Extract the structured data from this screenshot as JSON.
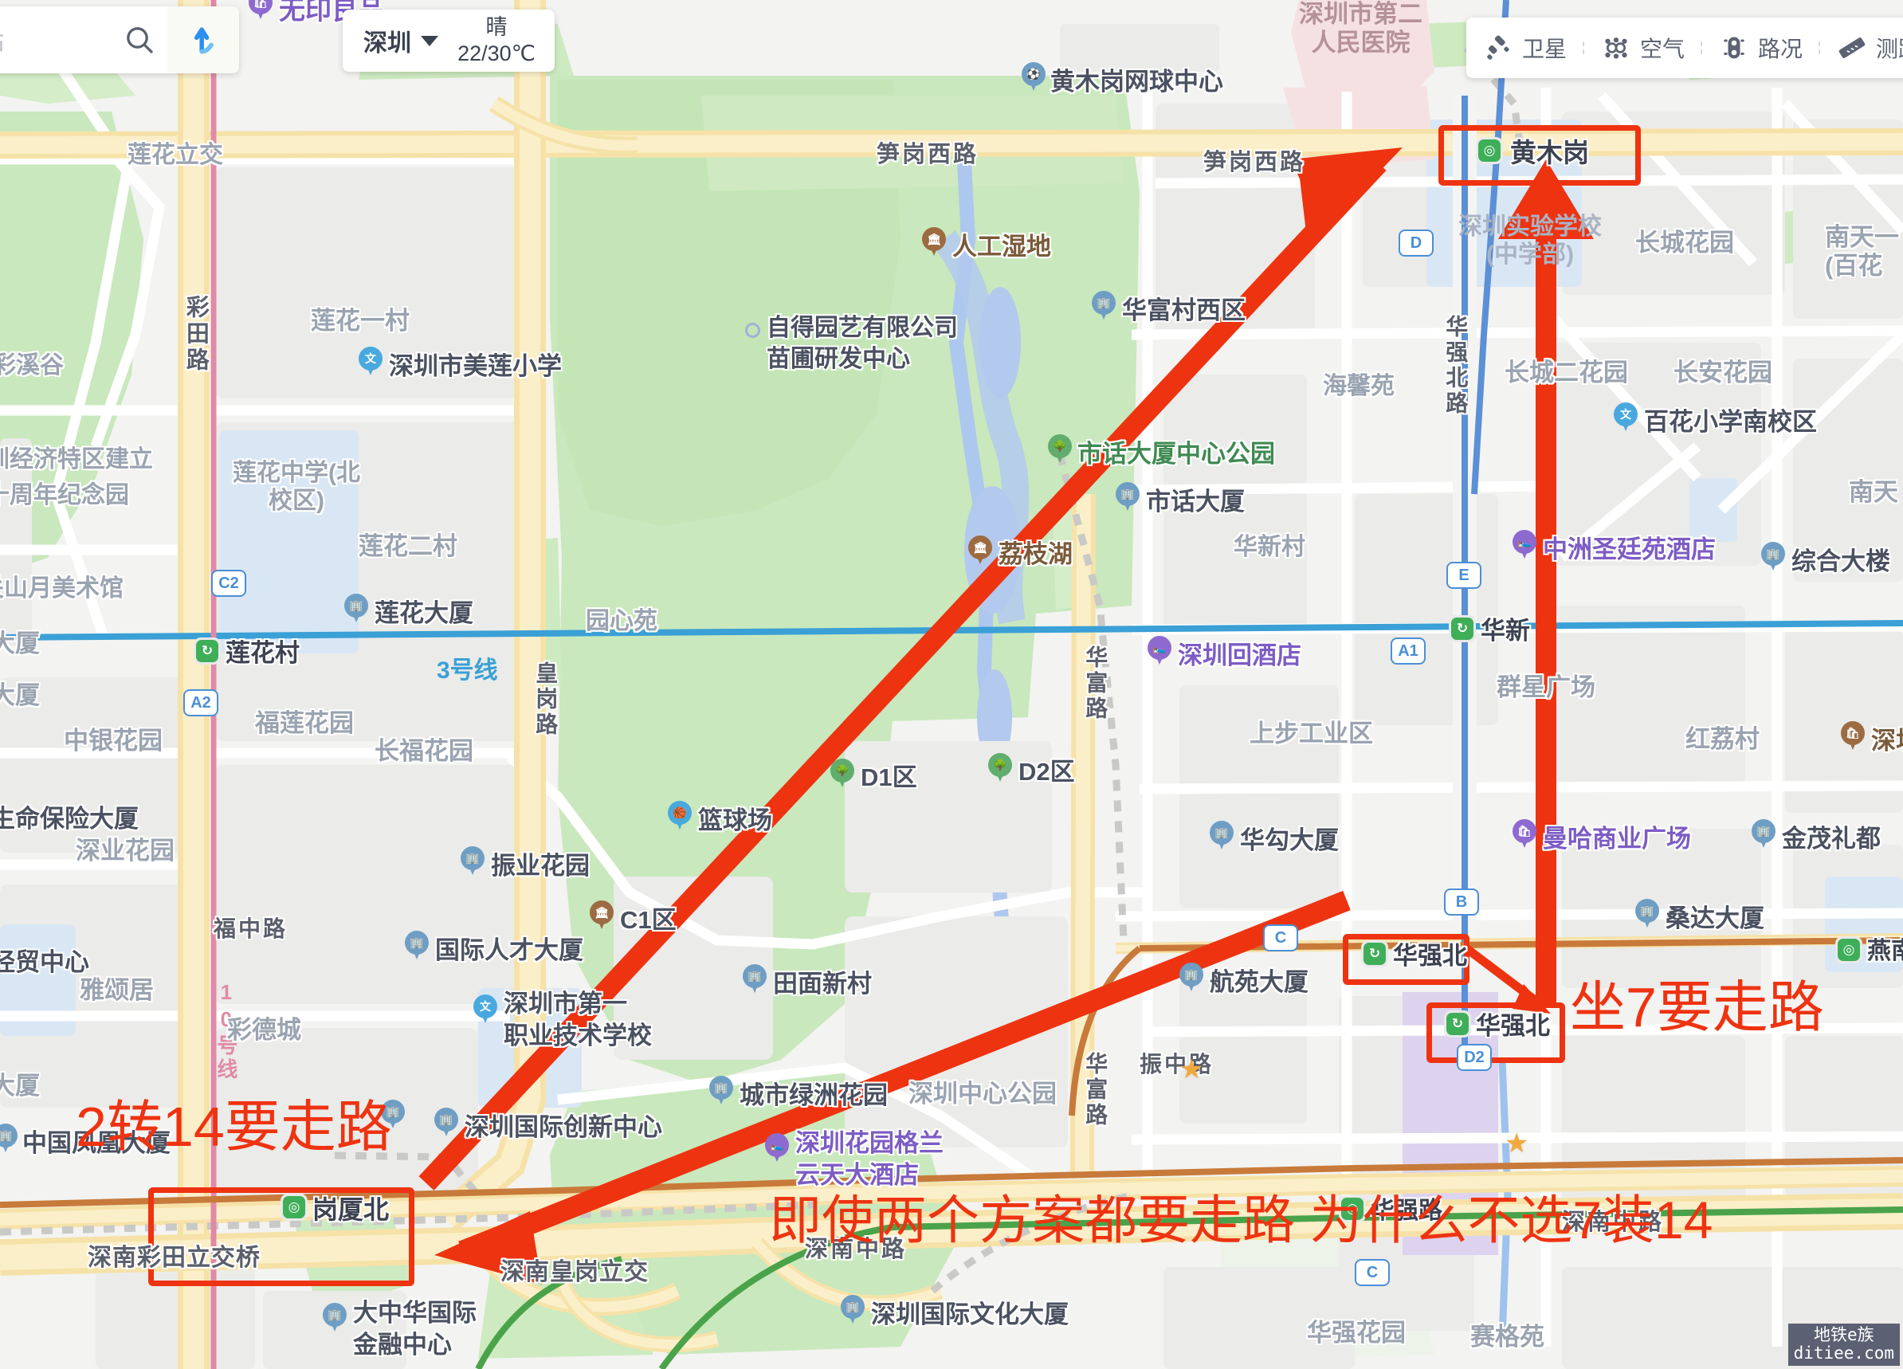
{
  "app": {
    "search": {
      "placeholder": "站、地铁站",
      "search_icon": "search-icon",
      "direction_icon": "route-arrow-icon"
    },
    "city": {
      "name": "深圳",
      "weather_condition": "晴",
      "weather_temp": "22/30℃",
      "caret_icon": "chevron-down-icon"
    },
    "toolbar": [
      {
        "label": "卫星",
        "icon": "satellite-icon"
      },
      {
        "label": "空气",
        "icon": "air-quality-icon"
      },
      {
        "label": "路况",
        "icon": "traffic-light-icon"
      },
      {
        "label": "测距",
        "icon": "ruler-icon"
      }
    ],
    "watermark": {
      "line1": "地铁e族",
      "line2": "ditiee.com"
    }
  },
  "annotations": {
    "colors": {
      "red": "#ee3311"
    },
    "texts": [
      {
        "id": "ann-2to14",
        "text": "2转14要走路"
      },
      {
        "id": "ann-line7",
        "text": "坐7要走路"
      },
      {
        "id": "ann-question",
        "text": "即使两个方案都要走路 为什么不选7装14"
      }
    ],
    "highlight_boxes": [
      {
        "id": "box-huangmugang",
        "station": "黄木岗"
      },
      {
        "id": "box-huaqiangbei-upper",
        "station": "华强北"
      },
      {
        "id": "box-huaqiangbei-lower",
        "station": "华强北"
      },
      {
        "id": "box-gangxiabei",
        "station": "岗厦北"
      }
    ],
    "arrows": [
      {
        "id": "arrow-to-huangmugang",
        "from": "岗厦北区域",
        "to": "黄木岗"
      },
      {
        "id": "arrow-to-gangxiabei",
        "from": "华强北区域",
        "to": "岗厦北"
      },
      {
        "id": "arrow-up-huangmugang",
        "from": "华强北",
        "to": "黄木岗"
      },
      {
        "id": "arrow-short-huaqiangbei",
        "from": "华强北上",
        "to": "华强北下"
      }
    ]
  },
  "map": {
    "metro_lines": [
      {
        "name": "3号线",
        "color": "#3aa0d6"
      },
      {
        "name": "10号线",
        "color": "#e08aa6"
      }
    ],
    "stations": [
      {
        "name": "黄木岗",
        "type": "normal"
      },
      {
        "name": "华新",
        "type": "transfer"
      },
      {
        "name": "华强北",
        "type": "transfer"
      },
      {
        "name": "华强北",
        "type": "transfer"
      },
      {
        "name": "华强路",
        "type": "normal"
      },
      {
        "name": "莲花村",
        "type": "transfer"
      },
      {
        "name": "岗厦北",
        "type": "normal"
      },
      {
        "name": "燕南",
        "type": "normal"
      }
    ],
    "exits": [
      "C2",
      "A2",
      "A1",
      "B",
      "C",
      "D",
      "E",
      "D2"
    ],
    "roads": [
      "笋岗西路",
      "笋岗西路",
      "彩田路",
      "华强北路",
      "皇岗路",
      "华富路",
      "福中路",
      "振中路",
      "华富路",
      "深南中路",
      "深南中路",
      "深南彩田立交桥",
      "深南皇岗立交",
      "3号线",
      "10号线"
    ],
    "area_labels": [
      "莲花立交",
      "莲花一村",
      "莲花中学(北校区)",
      "莲花二村",
      "彩溪谷",
      "圳经济特区建立",
      "十周年纪念园",
      "关山月美术馆",
      "园心苑",
      "福莲花园",
      "长福花园",
      "中银花园",
      "深业花园",
      "雅颂居",
      "彩德城",
      "海馨苑",
      "华新村",
      "上步工业区",
      "群星广场",
      "长城花园",
      "长城二花园",
      "长安花园",
      "南天一(百花",
      "南天",
      "红荔村",
      "深圳中心公园",
      "华强花园",
      "赛格苑"
    ],
    "pois": [
      {
        "name": "黄木岗网球中心",
        "icon": "sports-pin",
        "color": "blue"
      },
      {
        "name": "人工湿地",
        "icon": "landmark-pin",
        "color": "brown"
      },
      {
        "name": "自得园艺有限公司\n苗圃研发中心",
        "icon": "dot",
        "color": "none"
      },
      {
        "name": "深圳市美莲小学",
        "icon": "school-pin",
        "color": "cyan"
      },
      {
        "name": "华富村西区",
        "icon": "building-pin",
        "color": "blue"
      },
      {
        "name": "市话大厦中心公园",
        "icon": "park-pin",
        "color": "green"
      },
      {
        "name": "市话大厦",
        "icon": "building-pin",
        "color": "blue"
      },
      {
        "name": "莲花大厦",
        "icon": "building-pin",
        "color": "blue"
      },
      {
        "name": "荔枝湖",
        "icon": "landmark-pin",
        "color": "brown"
      },
      {
        "name": "深圳回酒店",
        "icon": "hotel-pin",
        "color": "purple"
      },
      {
        "name": "中洲圣廷苑酒店",
        "icon": "hotel-pin",
        "color": "purple"
      },
      {
        "name": "百花小学南校区",
        "icon": "school-pin",
        "color": "cyan"
      },
      {
        "name": "综合大楼",
        "icon": "building-pin",
        "color": "blue"
      },
      {
        "name": "深圳",
        "icon": "shop-pin",
        "color": "brown"
      },
      {
        "name": "D1区",
        "icon": "park-pin",
        "color": "green"
      },
      {
        "name": "D2区",
        "icon": "park-pin",
        "color": "green"
      },
      {
        "name": "C1区",
        "icon": "landmark-pin",
        "color": "brown"
      },
      {
        "name": "篮球场",
        "icon": "sports-pin",
        "color": "cyan"
      },
      {
        "name": "振业花园",
        "icon": "building-pin",
        "color": "blue"
      },
      {
        "name": "国际人才大厦",
        "icon": "building-pin",
        "color": "blue"
      },
      {
        "name": "田面新村",
        "icon": "building-pin",
        "color": "blue"
      },
      {
        "name": "深圳市第一\n职业技术学校",
        "icon": "school-pin",
        "color": "cyan"
      },
      {
        "name": "城市绿洲花园",
        "icon": "building-pin",
        "color": "blue"
      },
      {
        "name": "深圳国际创新中心",
        "icon": "building-pin",
        "color": "blue"
      },
      {
        "name": "深圳花园格兰\n云天大酒店",
        "icon": "hotel-pin",
        "color": "purple"
      },
      {
        "name": "深圳国际文化大厦",
        "icon": "building-pin",
        "color": "blue"
      },
      {
        "name": "华勾大厦",
        "icon": "building-pin",
        "color": "blue"
      },
      {
        "name": "航苑大厦",
        "icon": "building-pin",
        "color": "blue"
      },
      {
        "name": "曼哈商业广场",
        "icon": "shop-pin",
        "color": "purple"
      },
      {
        "name": "金茂礼都",
        "icon": "building-pin",
        "color": "blue"
      },
      {
        "name": "桑达大厦",
        "icon": "building-pin",
        "color": "blue"
      },
      {
        "name": "生命保险大厦",
        "icon": "none",
        "color": "none"
      },
      {
        "name": "中国凤凰大厦",
        "icon": "building-pin",
        "color": "blue"
      },
      {
        "name": "中华自核大厦",
        "icon": "building-pin",
        "color": "blue"
      },
      {
        "name": "大中华国际\n金融中心",
        "icon": "building-pin",
        "color": "blue"
      },
      {
        "name": "无印良品",
        "icon": "shop-pin",
        "color": "purple"
      },
      {
        "name": "深圳市第二\n人民医院",
        "icon": "none",
        "color": "none"
      },
      {
        "name": "深圳实验学校\n(中学部)",
        "icon": "none",
        "color": "none"
      },
      {
        "name": "深圳市美莲小学",
        "icon": "school-pin",
        "color": "cyan"
      }
    ]
  }
}
